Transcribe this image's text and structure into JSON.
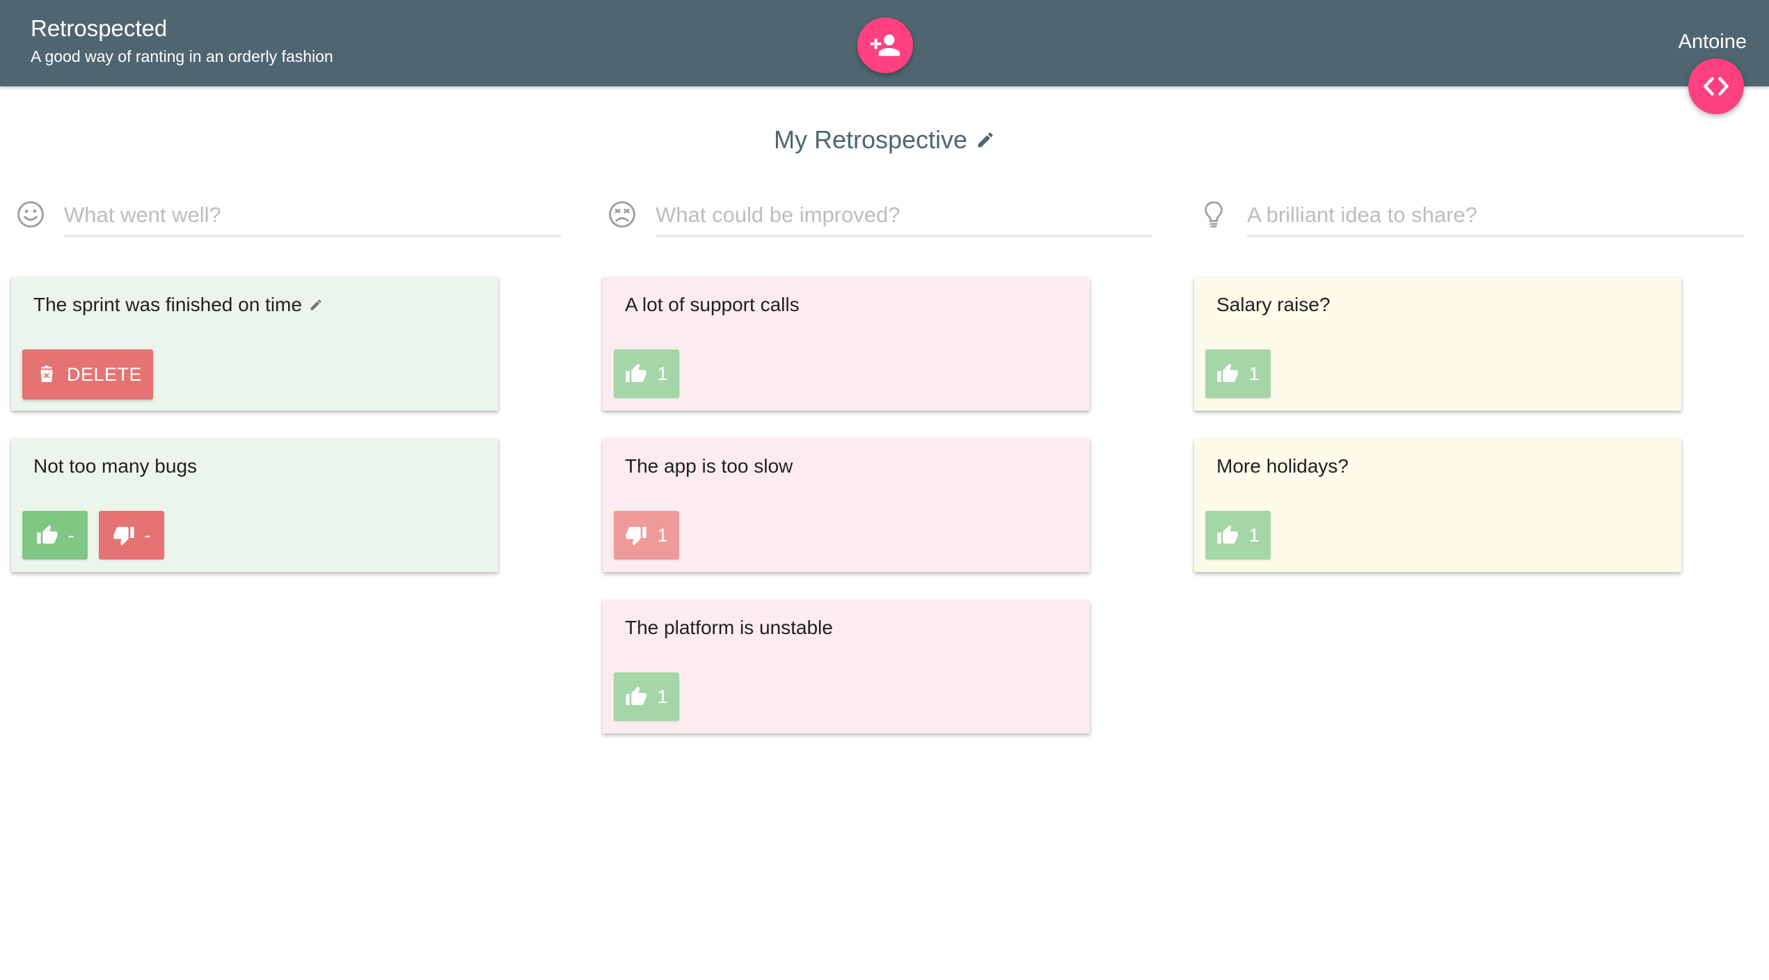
{
  "app": {
    "title": "Retrospected",
    "subtitle": "A good way of ranting in an orderly fashion",
    "user": "Antoine"
  },
  "icons": {
    "invite": "person-add-icon",
    "code": "code-brackets-icon",
    "edit": "pencil-icon",
    "well": "smiley-icon",
    "improve": "frown-icon",
    "idea": "lightbulb-icon",
    "like": "thumbs-up-icon",
    "dislike": "thumbs-down-icon",
    "delete": "trash-icon"
  },
  "colors": {
    "appbar": "#4f6670",
    "accent": "#ff4081",
    "well_card": "#ebf5ec",
    "improve_card": "#fdecef",
    "idea_card": "#fdfbe9",
    "like": "#81c784",
    "dislike": "#e57373"
  },
  "retro": {
    "title": "My Retrospective"
  },
  "columns": [
    {
      "placeholder": "What went well?",
      "value": "",
      "cards": [
        {
          "text": "The sprint was finished on time",
          "delete_label": "DELETE"
        },
        {
          "text": "Not too many bugs",
          "likes": "-",
          "dislikes": "-"
        }
      ]
    },
    {
      "placeholder": "What could be improved?",
      "value": "",
      "cards": [
        {
          "text": "A lot of support calls",
          "likes": "1"
        },
        {
          "text": "The app is too slow",
          "dislikes": "1"
        },
        {
          "text": "The platform is unstable",
          "likes": "1"
        }
      ]
    },
    {
      "placeholder": "A brilliant idea to share?",
      "value": "",
      "cards": [
        {
          "text": "Salary raise?",
          "likes": "1"
        },
        {
          "text": "More holidays?",
          "likes": "1"
        }
      ]
    }
  ]
}
